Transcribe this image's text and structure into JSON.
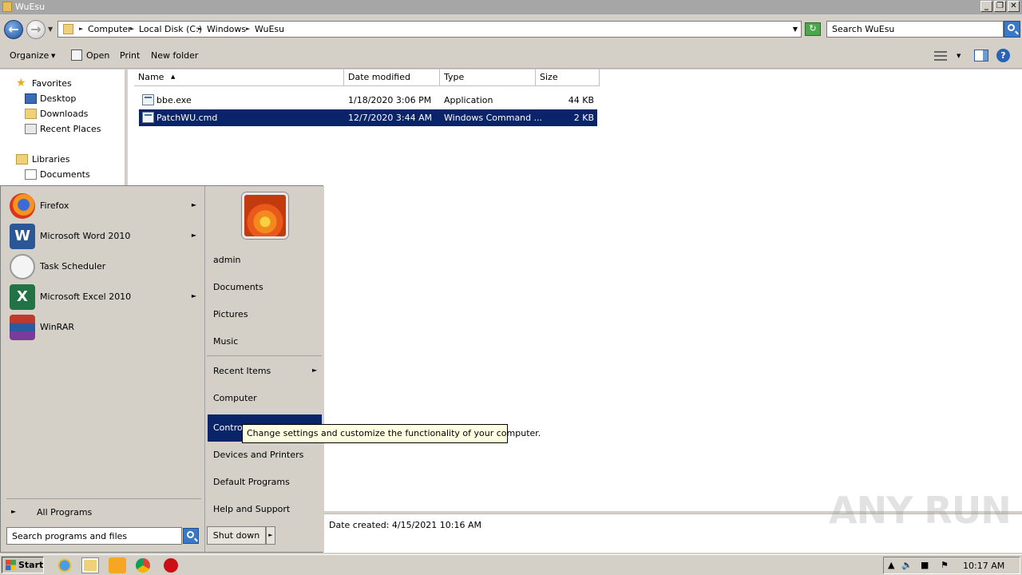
{
  "window": {
    "title": "WuEsu"
  },
  "address_bar": {
    "crumbs": [
      "Computer",
      "Local Disk (C:)",
      "Windows",
      "WuEsu"
    ],
    "search_placeholder": "Search WuEsu"
  },
  "toolbar": {
    "organize": "Organize",
    "open": "Open",
    "print": "Print",
    "new_folder": "New folder"
  },
  "nav_pane": {
    "favorites": "Favorites",
    "items": [
      "Desktop",
      "Downloads",
      "Recent Places"
    ],
    "libraries": "Libraries",
    "lib_items": [
      "Documents"
    ]
  },
  "columns": {
    "name": "Name",
    "date": "Date modified",
    "type": "Type",
    "size": "Size"
  },
  "files": [
    {
      "name": "bbe.exe",
      "date": "1/18/2020 3:06 PM",
      "type": "Application",
      "size": "44 KB"
    },
    {
      "name": "PatchWU.cmd",
      "date": "12/7/2020 3:44 AM",
      "type": "Windows Command ...",
      "size": "2 KB"
    }
  ],
  "details": {
    "text": "Date created: 4/15/2021 10:16 AM"
  },
  "start_menu": {
    "programs": [
      {
        "label": "Firefox"
      },
      {
        "label": "Microsoft Word 2010"
      },
      {
        "label": "Task Scheduler"
      },
      {
        "label": "Microsoft Excel 2010"
      },
      {
        "label": "WinRAR"
      }
    ],
    "all_programs": "All Programs",
    "search_placeholder": "Search programs and files",
    "right": {
      "user": "admin",
      "documents": "Documents",
      "pictures": "Pictures",
      "music": "Music",
      "recent_items": "Recent Items",
      "computer": "Computer",
      "control_panel": "Control Panel",
      "devices": "Devices and Printers",
      "default_programs": "Default Programs",
      "help": "Help and Support"
    },
    "shutdown": "Shut down"
  },
  "tooltip": "Change settings and customize the functionality of your computer.",
  "taskbar": {
    "start": "Start",
    "clock": "10:17 AM"
  },
  "watermark": "ANY RUN"
}
